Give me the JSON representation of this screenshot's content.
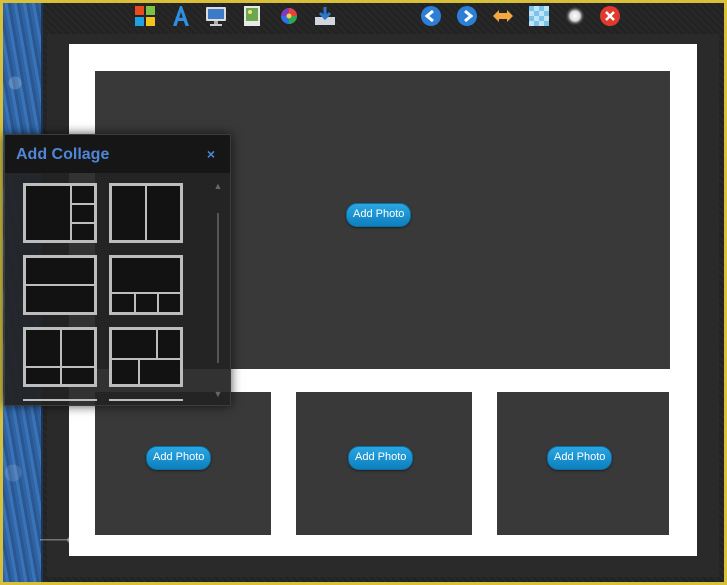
{
  "toolbar": {
    "icons": [
      "layout-icon",
      "text-icon",
      "monitor-icon",
      "image-icon",
      "color-wheel-icon",
      "save-icon",
      "undo-icon",
      "redo-icon",
      "swap-icon",
      "transparency-icon",
      "glow-icon",
      "close-icon"
    ]
  },
  "collage": {
    "slots": [
      {
        "button": "Add Photo"
      },
      {
        "button": "Add Photo"
      },
      {
        "button": "Add Photo"
      },
      {
        "button": "Add Photo"
      }
    ]
  },
  "panel": {
    "title": "Add Collage",
    "close_label": "×",
    "scroll_up": "▲",
    "scroll_down": "▼"
  },
  "colors": {
    "frame_border": "#d8c03a",
    "panel_title": "#4f86d8",
    "button": "#1a93d3",
    "slot": "#393939"
  }
}
